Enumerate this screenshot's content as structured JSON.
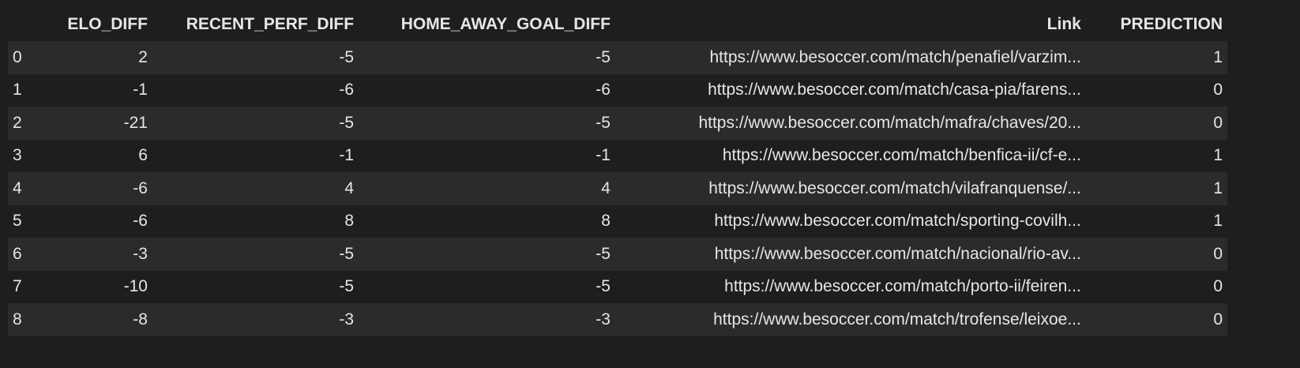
{
  "table": {
    "columns": [
      "",
      "ELO_DIFF",
      "RECENT_PERF_DIFF",
      "HOME_AWAY_GOAL_DIFF",
      "Link",
      "PREDICTION"
    ],
    "rows": [
      [
        "0",
        "2",
        "-5",
        "-5",
        "https://www.besoccer.com/match/penafiel/varzim...",
        "1"
      ],
      [
        "1",
        "-1",
        "-6",
        "-6",
        "https://www.besoccer.com/match/casa-pia/farens...",
        "0"
      ],
      [
        "2",
        "-21",
        "-5",
        "-5",
        "https://www.besoccer.com/match/mafra/chaves/20...",
        "0"
      ],
      [
        "3",
        "6",
        "-1",
        "-1",
        "https://www.besoccer.com/match/benfica-ii/cf-e...",
        "1"
      ],
      [
        "4",
        "-6",
        "4",
        "4",
        "https://www.besoccer.com/match/vilafranquense/...",
        "1"
      ],
      [
        "5",
        "-6",
        "8",
        "8",
        "https://www.besoccer.com/match/sporting-covilh...",
        "1"
      ],
      [
        "6",
        "-3",
        "-5",
        "-5",
        "https://www.besoccer.com/match/nacional/rio-av...",
        "0"
      ],
      [
        "7",
        "-10",
        "-5",
        "-5",
        "https://www.besoccer.com/match/porto-ii/feiren...",
        "0"
      ],
      [
        "8",
        "-8",
        "-3",
        "-3",
        "https://www.besoccer.com/match/trofense/leixoe...",
        "0"
      ]
    ]
  },
  "colors": {
    "background": "#1e1e1e",
    "row_stripe": "#2b2b2b",
    "text": "#e6e6e6"
  }
}
